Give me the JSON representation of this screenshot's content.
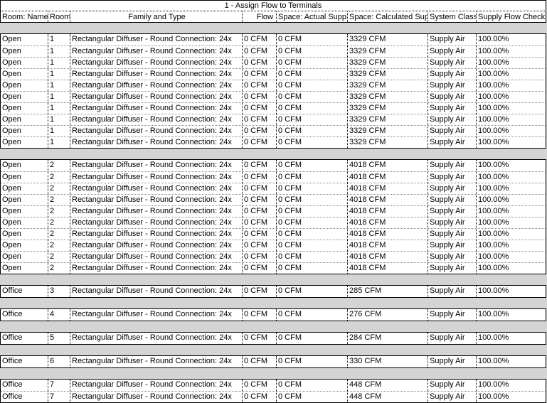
{
  "title": "1 - Assign Flow to Terminals",
  "headers": [
    "Room: Name",
    "Room",
    "Family and Type",
    "Flow",
    "Space: Actual Supp",
    "Space: Calculated Sup",
    "System Class",
    "Supply Flow Check"
  ],
  "groups": [
    {
      "rows": [
        [
          "Open",
          "1",
          "Rectangular Diffuser - Round Connection: 24x",
          "0 CFM",
          "0 CFM",
          "3329 CFM",
          "Supply Air",
          "100.00%"
        ],
        [
          "Open",
          "1",
          "Rectangular Diffuser - Round Connection: 24x",
          "0 CFM",
          "0 CFM",
          "3329 CFM",
          "Supply Air",
          "100.00%"
        ],
        [
          "Open",
          "1",
          "Rectangular Diffuser - Round Connection: 24x",
          "0 CFM",
          "0 CFM",
          "3329 CFM",
          "Supply Air",
          "100.00%"
        ],
        [
          "Open",
          "1",
          "Rectangular Diffuser - Round Connection: 24x",
          "0 CFM",
          "0 CFM",
          "3329 CFM",
          "Supply Air",
          "100.00%"
        ],
        [
          "Open",
          "1",
          "Rectangular Diffuser - Round Connection: 24x",
          "0 CFM",
          "0 CFM",
          "3329 CFM",
          "Supply Air",
          "100.00%"
        ],
        [
          "Open",
          "1",
          "Rectangular Diffuser - Round Connection: 24x",
          "0 CFM",
          "0 CFM",
          "3329 CFM",
          "Supply Air",
          "100.00%"
        ],
        [
          "Open",
          "1",
          "Rectangular Diffuser - Round Connection: 24x",
          "0 CFM",
          "0 CFM",
          "3329 CFM",
          "Supply Air",
          "100.00%"
        ],
        [
          "Open",
          "1",
          "Rectangular Diffuser - Round Connection: 24x",
          "0 CFM",
          "0 CFM",
          "3329 CFM",
          "Supply Air",
          "100.00%"
        ],
        [
          "Open",
          "1",
          "Rectangular Diffuser - Round Connection: 24x",
          "0 CFM",
          "0 CFM",
          "3329 CFM",
          "Supply Air",
          "100.00%"
        ],
        [
          "Open",
          "1",
          "Rectangular Diffuser - Round Connection: 24x",
          "0 CFM",
          "0 CFM",
          "3329 CFM",
          "Supply Air",
          "100.00%"
        ]
      ]
    },
    {
      "rows": [
        [
          "Open",
          "2",
          "Rectangular Diffuser - Round Connection: 24x",
          "0 CFM",
          "0 CFM",
          "4018 CFM",
          "Supply Air",
          "100.00%"
        ],
        [
          "Open",
          "2",
          "Rectangular Diffuser - Round Connection: 24x",
          "0 CFM",
          "0 CFM",
          "4018 CFM",
          "Supply Air",
          "100.00%"
        ],
        [
          "Open",
          "2",
          "Rectangular Diffuser - Round Connection: 24x",
          "0 CFM",
          "0 CFM",
          "4018 CFM",
          "Supply Air",
          "100.00%"
        ],
        [
          "Open",
          "2",
          "Rectangular Diffuser - Round Connection: 24x",
          "0 CFM",
          "0 CFM",
          "4018 CFM",
          "Supply Air",
          "100.00%"
        ],
        [
          "Open",
          "2",
          "Rectangular Diffuser - Round Connection: 24x",
          "0 CFM",
          "0 CFM",
          "4018 CFM",
          "Supply Air",
          "100.00%"
        ],
        [
          "Open",
          "2",
          "Rectangular Diffuser - Round Connection: 24x",
          "0 CFM",
          "0 CFM",
          "4018 CFM",
          "Supply Air",
          "100.00%"
        ],
        [
          "Open",
          "2",
          "Rectangular Diffuser - Round Connection: 24x",
          "0 CFM",
          "0 CFM",
          "4018 CFM",
          "Supply Air",
          "100.00%"
        ],
        [
          "Open",
          "2",
          "Rectangular Diffuser - Round Connection: 24x",
          "0 CFM",
          "0 CFM",
          "4018 CFM",
          "Supply Air",
          "100.00%"
        ],
        [
          "Open",
          "2",
          "Rectangular Diffuser - Round Connection: 24x",
          "0 CFM",
          "0 CFM",
          "4018 CFM",
          "Supply Air",
          "100.00%"
        ],
        [
          "Open",
          "2",
          "Rectangular Diffuser - Round Connection: 24x",
          "0 CFM",
          "0 CFM",
          "4018 CFM",
          "Supply Air",
          "100.00%"
        ]
      ]
    },
    {
      "rows": [
        [
          "Office",
          "3",
          "Rectangular Diffuser - Round Connection: 24x",
          "0 CFM",
          "0 CFM",
          "285 CFM",
          "Supply Air",
          "100.00%"
        ]
      ]
    },
    {
      "rows": [
        [
          "Office",
          "4",
          "Rectangular Diffuser - Round Connection: 24x",
          "0 CFM",
          "0 CFM",
          "276 CFM",
          "Supply Air",
          "100.00%"
        ]
      ]
    },
    {
      "rows": [
        [
          "Office",
          "5",
          "Rectangular Diffuser - Round Connection: 24x",
          "0 CFM",
          "0 CFM",
          "284 CFM",
          "Supply Air",
          "100.00%"
        ]
      ]
    },
    {
      "rows": [
        [
          "Office",
          "6",
          "Rectangular Diffuser - Round Connection: 24x",
          "0 CFM",
          "0 CFM",
          "330 CFM",
          "Supply Air",
          "100.00%"
        ]
      ]
    },
    {
      "rows": [
        [
          "Office",
          "7",
          "Rectangular Diffuser - Round Connection: 24x",
          "0 CFM",
          "0 CFM",
          "448 CFM",
          "Supply Air",
          "100.00%"
        ],
        [
          "Office",
          "7",
          "Rectangular Diffuser - Round Connection: 24x",
          "0 CFM",
          "0 CFM",
          "448 CFM",
          "Supply Air",
          "100.00%"
        ]
      ]
    }
  ]
}
